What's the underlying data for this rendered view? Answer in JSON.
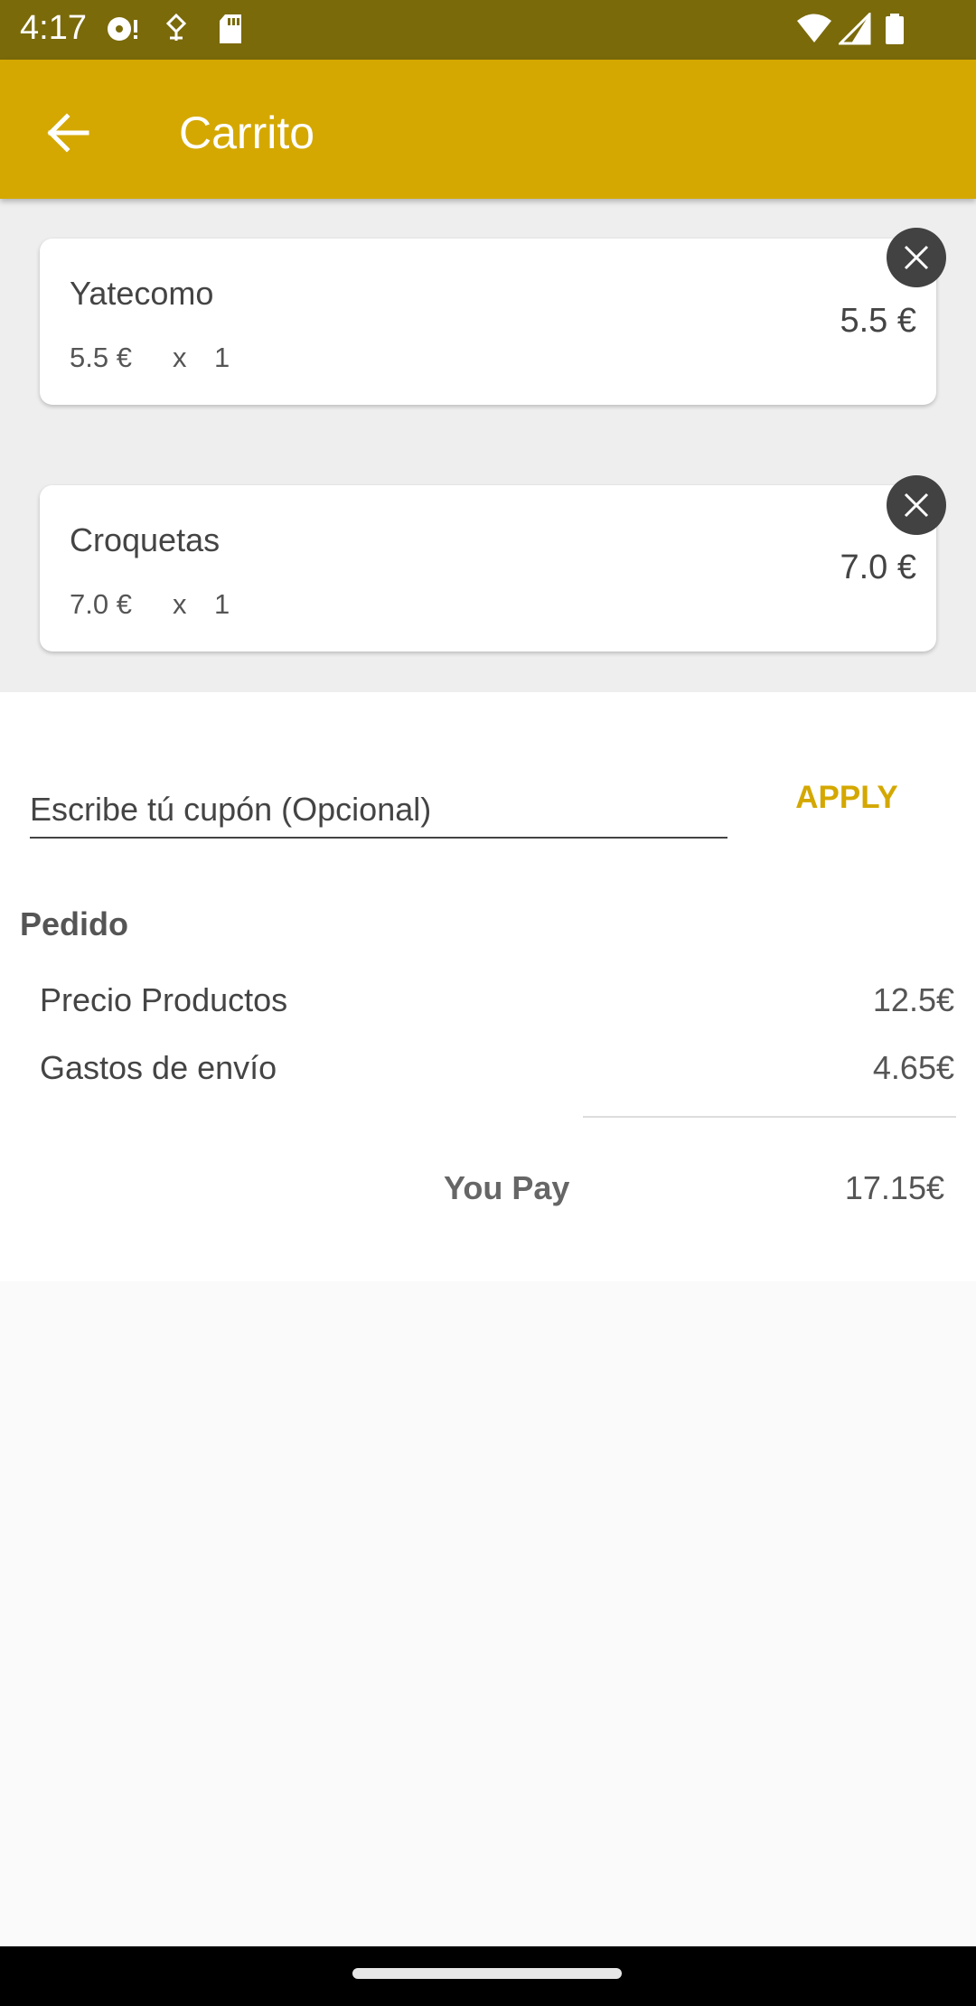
{
  "status_bar": {
    "time": "4:17",
    "icons": [
      "media-icon",
      "download-icon",
      "sd-card-icon",
      "wifi-icon",
      "signal-icon",
      "battery-icon"
    ]
  },
  "app_bar": {
    "title": "Carrito",
    "back_icon": "arrow-back-icon",
    "color": "#d4a800"
  },
  "cart": {
    "items": [
      {
        "name": "Yatecomo",
        "unit_price": "5.5 €",
        "times": "x",
        "quantity": "1",
        "total": "5.5 €"
      },
      {
        "name": "Croquetas",
        "unit_price": "7.0 €",
        "times": "x",
        "quantity": "1",
        "total": "7.0 €"
      }
    ],
    "remove_icon": "close-icon"
  },
  "coupon": {
    "placeholder": "Escribe tú cupón (Opcional)",
    "value": "",
    "apply_label": "APPLY"
  },
  "order": {
    "heading": "Pedido",
    "products_label": "Precio Productos",
    "products_value": "12.5€",
    "shipping_label": "Gastos de envío",
    "shipping_value": "4.65€",
    "pay_label": "You Pay",
    "pay_value": "17.15€"
  }
}
